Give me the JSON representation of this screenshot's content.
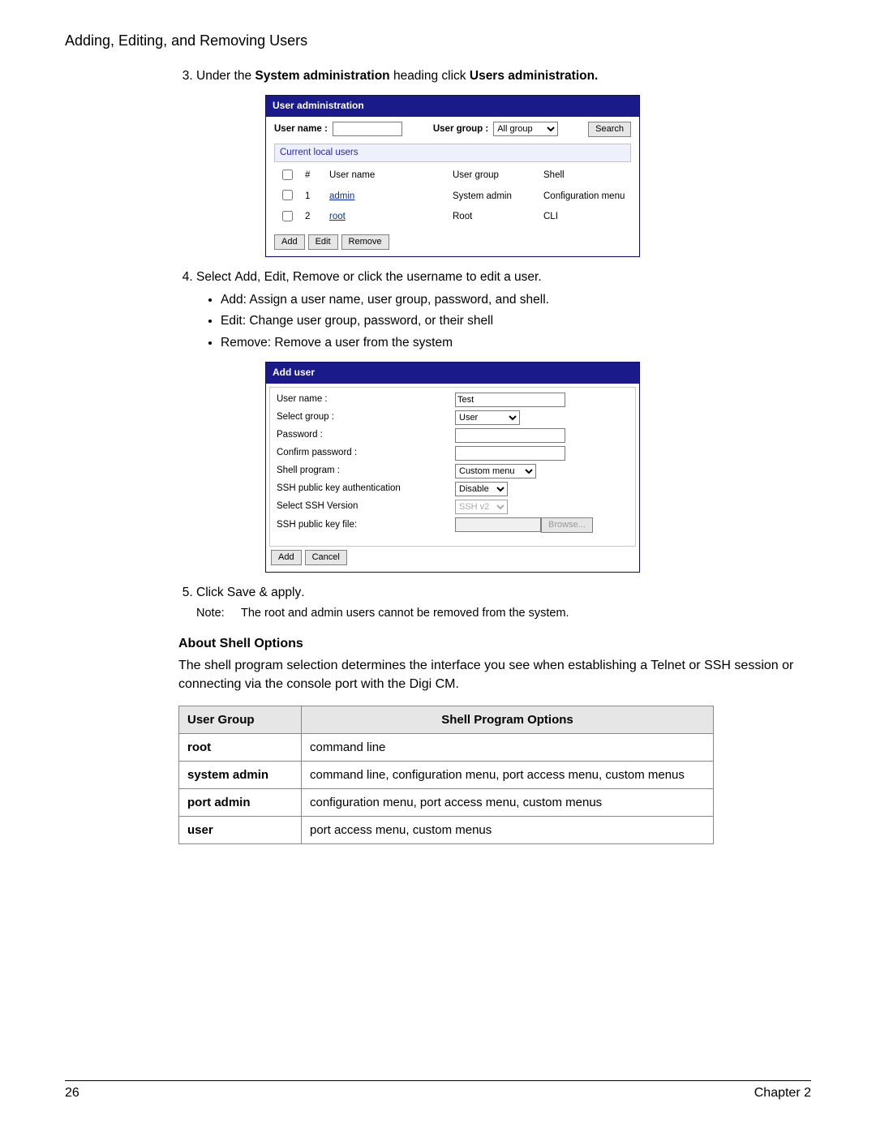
{
  "section_title": "Adding, Editing, and Removing Users",
  "step3": {
    "prefix": "Under the ",
    "bold1": "System administration",
    "mid": " heading click ",
    "bold2": "Users administration."
  },
  "user_admin_panel": {
    "title": "User administration",
    "username_label": "User name :",
    "usergroup_label": "User group :",
    "usergroup_value": "All group",
    "search_btn": "Search",
    "subhead": "Current local users",
    "col_hash": "#",
    "col_username": "User name",
    "col_usergroup": "User group",
    "col_shell": "Shell",
    "rows": [
      {
        "n": "1",
        "user": "admin",
        "group": "System admin",
        "shell": "Configuration menu"
      },
      {
        "n": "2",
        "user": "root",
        "group": "Root",
        "shell": "CLI"
      }
    ],
    "add_btn": "Add",
    "edit_btn": "Edit",
    "remove_btn": "Remove"
  },
  "step4": {
    "lead_a": "Select ",
    "lead_b": "Add",
    "lead_c": ", ",
    "lead_d": "Edit",
    "lead_e": ", ",
    "lead_f": "Remove",
    "lead_g": " or click the username to edit a user.",
    "bul1a": "Add",
    "bul1b": ": Assign a user name, user group, password, and shell.",
    "bul2a": "Edit",
    "bul2b": ": Change user group, password, or their shell",
    "bul3a": "Remove",
    "bul3b": ": Remove a user from the system"
  },
  "add_user_panel": {
    "title": "Add user",
    "rows": {
      "username_l": "User name :",
      "username_v": "Test",
      "group_l": "Select group :",
      "group_v": "User",
      "password_l": "Password :",
      "confirm_l": "Confirm password :",
      "shell_l": "Shell program :",
      "shell_v": "Custom menu",
      "sshauth_l": "SSH public key authentication",
      "sshauth_v": "Disable",
      "sshver_l": "Select SSH Version",
      "sshver_v": "SSH v2",
      "keyfile_l": "SSH public key file:",
      "browse_btn": "Browse..."
    },
    "add_btn": "Add",
    "cancel_btn": "Cancel"
  },
  "step5": {
    "a": "Click ",
    "b": "Save & apply",
    "c": "."
  },
  "note": {
    "l": "Note:",
    "t": "The root and admin users cannot be removed from the system."
  },
  "about": {
    "heading": "About Shell Options",
    "body": "The shell program selection determines the interface you see when establishing a Telnet or SSH session or connecting via the console port with the Digi CM."
  },
  "shell_table": {
    "h1": "User Group",
    "h2": "Shell Program Options",
    "rows": [
      {
        "g": "root",
        "o": "command line"
      },
      {
        "g": "system admin",
        "o": "command line, configuration menu, port access menu, custom menus"
      },
      {
        "g": "port admin",
        "o": "configuration menu, port access menu, custom menus"
      },
      {
        "g": "user",
        "o": "port access menu, custom menus"
      }
    ]
  },
  "footer": {
    "page": "26",
    "chapter": "Chapter 2"
  }
}
